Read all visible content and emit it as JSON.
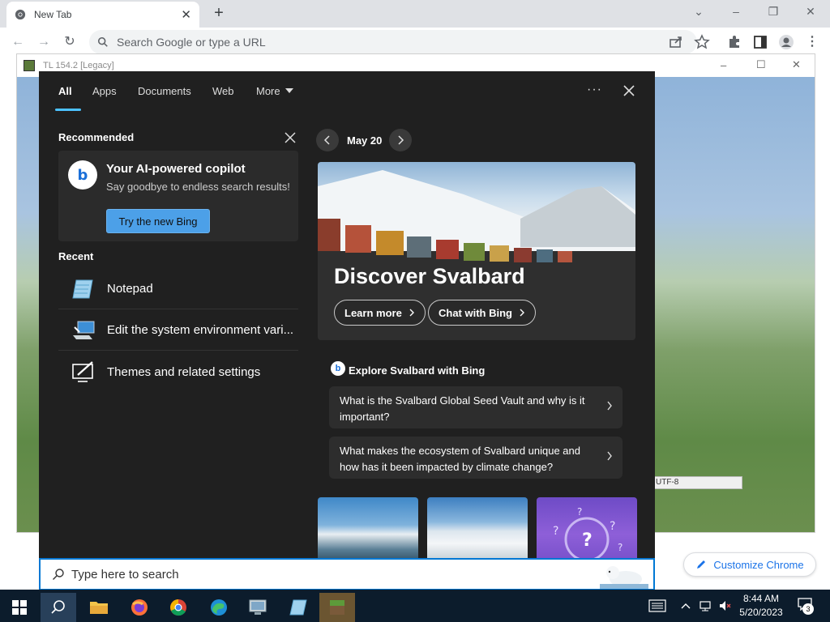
{
  "chrome": {
    "tab_title": "New Tab",
    "omnibox_placeholder": "Search Google or type a URL",
    "customize_label": "Customize Chrome"
  },
  "inner_window": {
    "title": "TL 154.2 [Legacy]",
    "status_text": "UTF-8"
  },
  "search_panel": {
    "tabs": [
      {
        "label": "All"
      },
      {
        "label": "Apps"
      },
      {
        "label": "Documents"
      },
      {
        "label": "Web"
      },
      {
        "label": "More"
      }
    ],
    "recommended": {
      "title": "Recommended",
      "card_heading": "Your AI-powered copilot",
      "card_sub": "Say goodbye to endless search results!",
      "card_button": "Try the new Bing"
    },
    "recent": {
      "title": "Recent",
      "items": [
        {
          "label": "Notepad"
        },
        {
          "label": "Edit the system environment vari..."
        },
        {
          "label": "Themes and related settings"
        }
      ]
    },
    "date_label": "May 20",
    "hero": {
      "title": "Discover Svalbard",
      "learn_more": "Learn more",
      "chat_with_bing": "Chat with Bing"
    },
    "explore": {
      "title": "Explore Svalbard with Bing",
      "questions": [
        {
          "text": "What is the Svalbard Global Seed Vault and why is it important?"
        },
        {
          "text": "What makes the ecosystem of Svalbard unique and how has it been impacted by climate change?"
        }
      ]
    },
    "search_placeholder": "Type here to search"
  },
  "taskbar": {
    "time": "8:44 AM",
    "date": "5/20/2023",
    "notification_count": "3"
  },
  "colors": {
    "panel_bg": "#202020",
    "accent": "#4cc2ff",
    "taskbar_bg": "#0c1c2c",
    "bing_button": "#4ca0e8"
  }
}
